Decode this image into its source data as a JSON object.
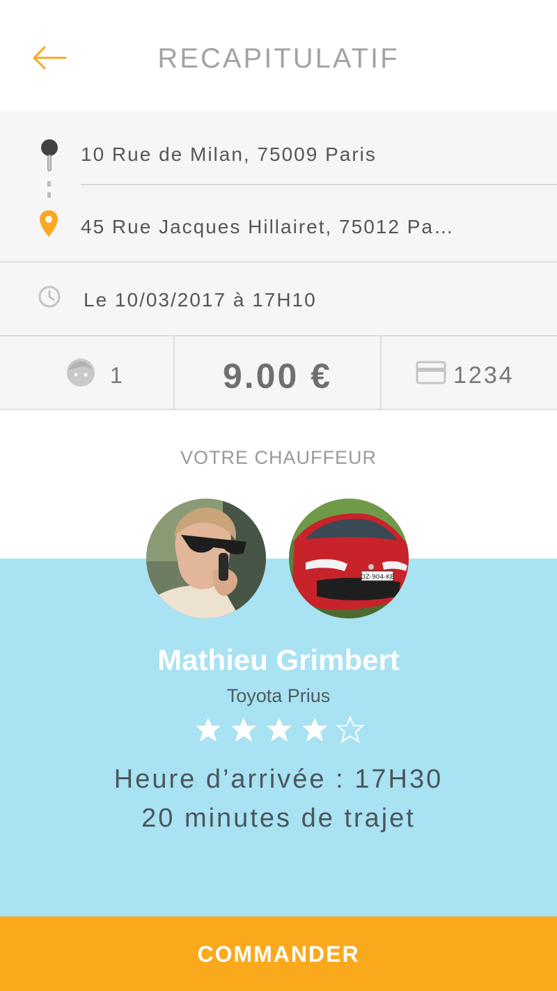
{
  "header": {
    "title": "RECAPITULATIF",
    "back_icon": "arrow-left-icon"
  },
  "route": {
    "pickup_address": "10 Rue de Milan, 75009 Paris",
    "destination_address": "45 Rue Jacques Hillairet, 75012 Pa…",
    "pickup_icon": "pin-icon",
    "destination_icon": "location-marker-icon"
  },
  "schedule": {
    "datetime": "Le 10/03/2017 à 17H10",
    "icon": "clock-icon"
  },
  "summary": {
    "passengers": "1",
    "passenger_icon": "face-icon",
    "price": "9.00 €",
    "card_last_digits": "1234",
    "card_icon": "credit-card-icon"
  },
  "driver": {
    "section_title": "VOTRE CHAUFFEUR",
    "name": "Mathieu Grimbert",
    "car_model": "Toyota Prius",
    "plate": "DZ-904-KE",
    "rating": 4,
    "rating_max": 5,
    "arrival": "Heure d’arrivée : 17H30",
    "duration": "20 minutes de trajet"
  },
  "actions": {
    "order_label": "COMMANDER"
  },
  "colors": {
    "accent": "#fba91c",
    "panel": "#a8e2f3",
    "text": "#555555"
  }
}
